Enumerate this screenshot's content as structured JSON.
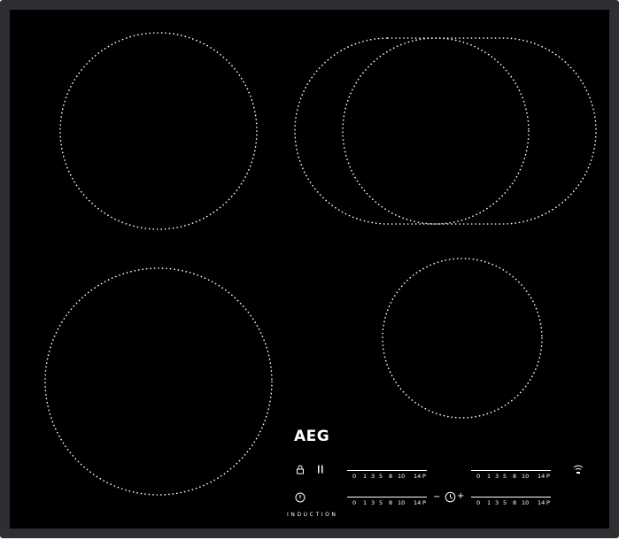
{
  "brand": {
    "logo_text": "AEG",
    "tagline": "INDUCTION"
  },
  "controls": {
    "lock_icon": "lock-icon",
    "pause_icon": "pause-icon",
    "power_icon": "power-icon",
    "wifi_icon": "hob2hood-wifi-icon",
    "timer_minus": "−",
    "timer_plus": "+",
    "timer_icon": "timer-icon"
  },
  "power_scale": {
    "labels": [
      "0",
      "1",
      "3",
      "5",
      "8",
      "10",
      "14",
      "P"
    ]
  },
  "colors": {
    "glass": "#000000",
    "frame": "#2f2f33",
    "markings": "#ffffff"
  }
}
